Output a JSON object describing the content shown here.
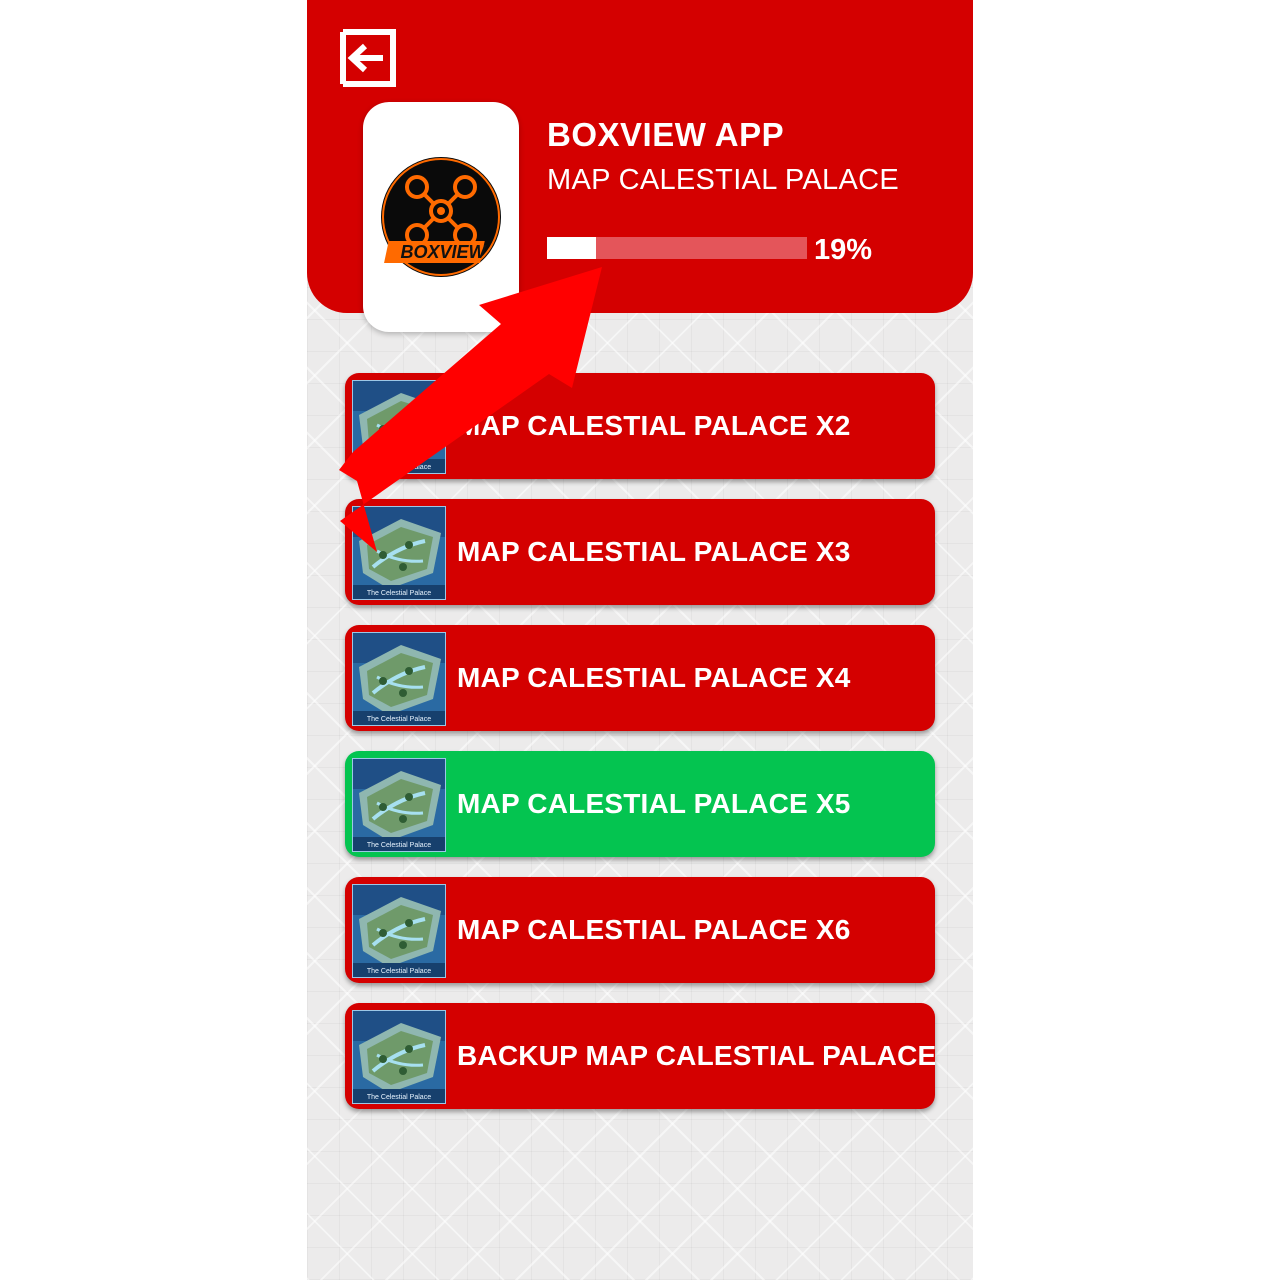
{
  "header": {
    "title": "BOXVIEW APP",
    "subtitle": "MAP CALESTIAL PALACE",
    "progress_percent": 19,
    "progress_label": "19%",
    "logo_text": "BOXVIEW"
  },
  "colors": {
    "header_red": "#d40000",
    "button_red": "#d40000",
    "active_green": "#04c450",
    "arrow_red": "#ff0000"
  },
  "map_buttons": [
    {
      "label": "MAP CALESTIAL PALACE X2",
      "thumb_caption": "The Celestial Palace",
      "active": false
    },
    {
      "label": "MAP CALESTIAL PALACE X3",
      "thumb_caption": "The Celestial Palace",
      "active": false
    },
    {
      "label": "MAP CALESTIAL PALACE X4",
      "thumb_caption": "The Celestial Palace",
      "active": false
    },
    {
      "label": "MAP CALESTIAL PALACE X5",
      "thumb_caption": "The Celestial Palace",
      "active": true
    },
    {
      "label": "MAP CALESTIAL PALACE X6",
      "thumb_caption": "The Celestial Palace",
      "active": false
    },
    {
      "label": "BACKUP MAP CALESTIAL PALACE",
      "thumb_caption": "The Celestial Palace",
      "active": false
    }
  ],
  "icons": {
    "back": "exit-arrow-icon",
    "logo": "drone-logo-icon",
    "thumbnail": "map-thumbnail"
  }
}
